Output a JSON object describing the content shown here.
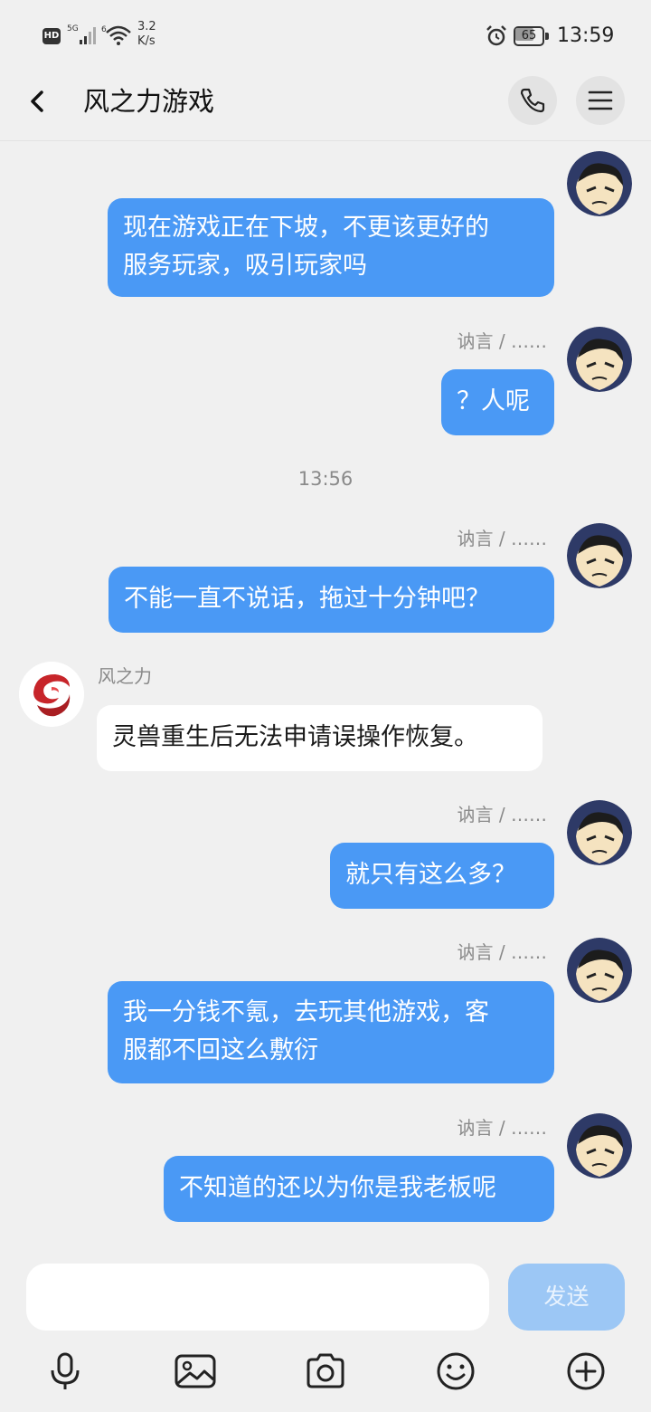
{
  "status_bar": {
    "hd": "HD",
    "network": "5G",
    "wifi_badge": "6",
    "speed_value": "3.2",
    "speed_unit": "K/s",
    "battery": "65",
    "time": "13:59"
  },
  "header": {
    "title": "风之力游戏",
    "back_icon": "chevron-left-icon",
    "call_icon": "phone-icon",
    "menu_icon": "hamburger-menu-icon"
  },
  "messages": [
    {
      "direction": "out",
      "sender": "",
      "text_lines": [
        "现在游戏正在下坡，不更该更好的",
        "服务玩家，吸引玩家吗"
      ]
    },
    {
      "direction": "out",
      "sender": "讷言 / ……",
      "text_lines": [
        "？人呢"
      ]
    },
    {
      "type": "timestamp",
      "text": "13:56"
    },
    {
      "direction": "out",
      "sender": "讷言 / ……",
      "text_lines": [
        "不能一直不说话，拖过十分钟吧？"
      ]
    },
    {
      "direction": "in",
      "sender": "风之力",
      "text_lines": [
        "灵兽重生后无法申请误操作恢复。"
      ]
    },
    {
      "direction": "out",
      "sender": "讷言 / ……",
      "text_lines": [
        "就只有这么多？"
      ]
    },
    {
      "direction": "out",
      "sender": "讷言 / ……",
      "text_lines": [
        "我一分钱不氪，去玩其他游戏，客",
        "服都不回这么敷衍"
      ]
    },
    {
      "direction": "out",
      "sender": "讷言 / ……",
      "text_lines": [
        "不知道的还以为你是我老板呢"
      ]
    }
  ],
  "composer": {
    "value": "",
    "placeholder": "",
    "send_label": "发送"
  },
  "toolbar": {
    "icons": [
      "microphone-icon",
      "image-icon",
      "camera-icon",
      "emoji-icon",
      "plus-icon"
    ]
  },
  "colors": {
    "outgoing_bubble": "#4a99f5",
    "incoming_bubble": "#ffffff",
    "background": "#f0f0f0",
    "send_button_disabled": "#9cc7f5"
  }
}
